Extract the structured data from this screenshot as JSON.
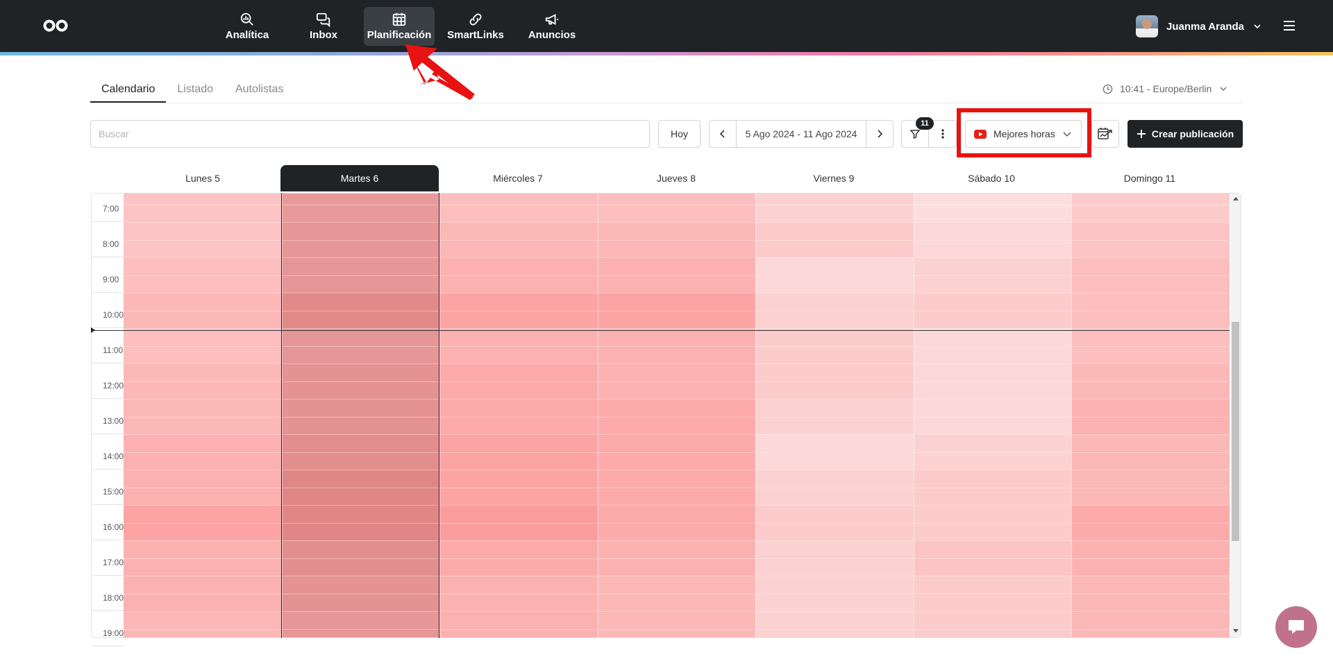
{
  "nav": {
    "items": [
      {
        "label": "Analítica",
        "icon": "analytics-icon"
      },
      {
        "label": "Inbox",
        "icon": "inbox-icon"
      },
      {
        "label": "Planificación",
        "icon": "calendar-icon",
        "active": true
      },
      {
        "label": "SmartLinks",
        "icon": "link-icon"
      },
      {
        "label": "Anuncios",
        "icon": "megaphone-icon"
      }
    ],
    "user_name": "Juanma Aranda"
  },
  "tabs": [
    {
      "label": "Calendario",
      "active": true
    },
    {
      "label": "Listado"
    },
    {
      "label": "Autolistas"
    }
  ],
  "timezone": "10:41 - Europe/Berlin",
  "toolbar": {
    "search_placeholder": "Buscar",
    "today_label": "Hoy",
    "date_range": "5 Ago 2024 - 11 Ago 2024",
    "filter_count": "11",
    "best_hours_label": "Mejores horas",
    "best_hours_network": "youtube-icon",
    "create_label": "Crear publicación"
  },
  "calendar": {
    "days": [
      "Lunes 5",
      "Martes 6",
      "Miércoles 7",
      "Jueves 8",
      "Viernes 9",
      "Sábado 10",
      "Domingo 11"
    ],
    "active_day": 1,
    "hours": [
      "7:00",
      "8:00",
      "9:00",
      "10:00",
      "11:00",
      "12:00",
      "13:00",
      "14:00",
      "15:00",
      "16:00",
      "17:00",
      "18:00",
      "19:00"
    ],
    "heat_scale_comment_free": true,
    "heat": [
      [
        0.3,
        0.3,
        0.35,
        0.4,
        0.35,
        0.4,
        0.4,
        0.45,
        0.45,
        0.55,
        0.45,
        0.45,
        0.4
      ],
      [
        0.45,
        0.5,
        0.5,
        0.65,
        0.5,
        0.55,
        0.55,
        0.6,
        0.7,
        0.7,
        0.6,
        0.55,
        0.5
      ],
      [
        0.35,
        0.4,
        0.45,
        0.55,
        0.45,
        0.5,
        0.5,
        0.55,
        0.55,
        0.6,
        0.5,
        0.45,
        0.45
      ],
      [
        0.35,
        0.4,
        0.45,
        0.55,
        0.45,
        0.45,
        0.5,
        0.5,
        0.5,
        0.5,
        0.45,
        0.4,
        0.4
      ],
      [
        0.2,
        0.25,
        0.15,
        0.2,
        0.25,
        0.25,
        0.2,
        0.15,
        0.2,
        0.25,
        0.2,
        0.2,
        0.2
      ],
      [
        0.1,
        0.15,
        0.2,
        0.25,
        0.15,
        0.15,
        0.15,
        0.2,
        0.25,
        0.25,
        0.3,
        0.25,
        0.25
      ],
      [
        0.25,
        0.3,
        0.35,
        0.35,
        0.35,
        0.4,
        0.45,
        0.4,
        0.4,
        0.5,
        0.45,
        0.4,
        0.4
      ]
    ]
  }
}
